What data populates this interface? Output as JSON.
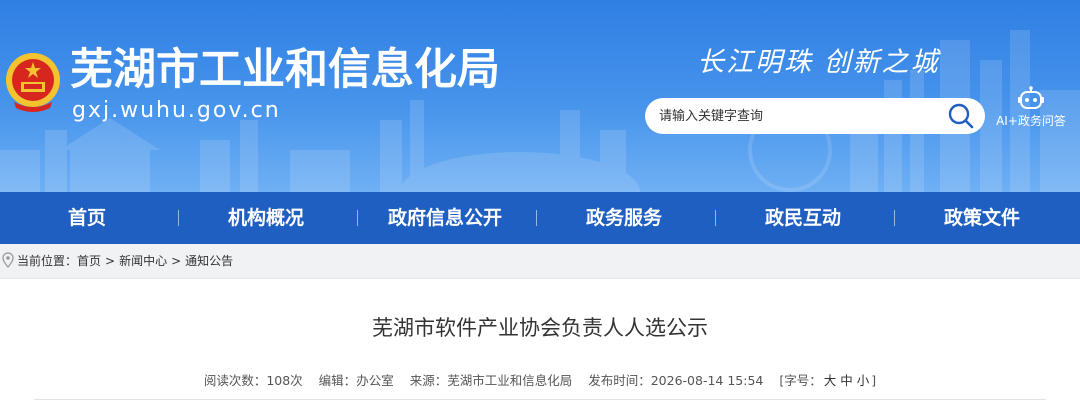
{
  "header": {
    "site_title": "芜湖市工业和信息化局",
    "site_domain": "gxj.wuhu.gov.cn",
    "slogan": "长江明珠  创新之城",
    "emblem_icon": "national-emblem-icon",
    "search": {
      "placeholder": "请输入关键字查询",
      "icon": "search-icon"
    },
    "ai_button": {
      "label": "AI+政务问答",
      "icon": "robot-icon"
    }
  },
  "nav": {
    "items": [
      {
        "label": "首页"
      },
      {
        "label": "机构概况"
      },
      {
        "label": "政府信息公开"
      },
      {
        "label": "政务服务"
      },
      {
        "label": "政民互动"
      },
      {
        "label": "政策文件"
      }
    ]
  },
  "breadcrumb": {
    "prefix": "当前位置：",
    "items": [
      "首页",
      "新闻中心",
      "通知公告"
    ],
    "separator": ">"
  },
  "article": {
    "title": "芜湖市软件产业协会负责人人选公示",
    "meta": {
      "views_label": "阅读次数：",
      "views_value": "108次",
      "editor_label": "编辑：",
      "editor_value": "办公室",
      "source_label": "来源：",
      "source_value": "芜湖市工业和信息化局",
      "date_label": "发布时间：",
      "date_value": "2026-08-14 15:54",
      "font_label": "[字号：",
      "font_large": "大",
      "font_medium": "中",
      "font_small": "小",
      "font_close": "]"
    }
  },
  "colors": {
    "banner_blue": "#2f7fe3",
    "nav_blue": "#1e5fc1",
    "page_bg": "#f1f2f4"
  }
}
